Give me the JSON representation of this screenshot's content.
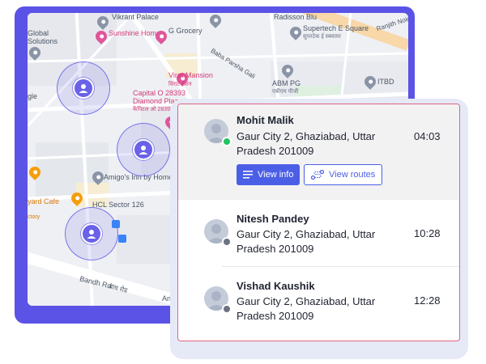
{
  "map": {
    "pois": [
      {
        "label": "Vikrant Palace",
        "style": "gray"
      },
      {
        "label": "Sunshine Homes",
        "style": "pink"
      },
      {
        "label": "G Grocery",
        "style": "gray"
      },
      {
        "label": "Radisson Blu",
        "style": "gray"
      },
      {
        "label": "Supertech E Square",
        "style": "gray"
      },
      {
        "label": "सुपरटेक ई स्क्वायर",
        "style": "sub"
      },
      {
        "label": "Global",
        "style": "gray"
      },
      {
        "label": "Solutions",
        "style": "gray"
      },
      {
        "label": "Virat Mansion",
        "style": "pink"
      },
      {
        "label": "विराट मेंशन",
        "style": "pinksub"
      },
      {
        "label": "Capital O 28393",
        "style": "pink"
      },
      {
        "label": "Diamond Plaza",
        "style": "pink"
      },
      {
        "label": "कैपिटल ओ 28393",
        "style": "pinksub"
      },
      {
        "label": "ABM PG",
        "style": "gray"
      },
      {
        "label": "एबीएम पीजी",
        "style": "sub"
      },
      {
        "label": "ITBD",
        "style": "gray"
      },
      {
        "label": "Amigo's Inn by Homestel",
        "style": "gray"
      },
      {
        "label": "yard Cafe",
        "style": "orange"
      },
      {
        "label": "ctory",
        "style": "orange"
      },
      {
        "label": "HCL Sector 126",
        "style": "gray"
      },
      {
        "label": "gle",
        "style": "gray"
      },
      {
        "label": "Anura",
        "style": "gray"
      }
    ],
    "roads": [
      {
        "label": "Baba Parsha Gali"
      },
      {
        "label": "Bandh Rd"
      },
      {
        "label": "बांध रोड"
      },
      {
        "label": "Ranjith Noida"
      }
    ]
  },
  "geofences": [
    {
      "avatar_icon": "person-icon"
    },
    {
      "avatar_icon": "person-icon"
    },
    {
      "avatar_icon": "person-icon"
    }
  ],
  "drivers": [
    {
      "name": "Mohit Malik",
      "address": "Gaur City 2, Ghaziabad, Uttar Pradesh 201009",
      "time": "04:03",
      "status": "online",
      "status_color": "#22c55e",
      "buttons": {
        "view_info": "View info",
        "view_routes": "View routes"
      }
    },
    {
      "name": "Nitesh Pandey",
      "address": "Gaur City 2, Ghaziabad, Uttar Pradesh 201009",
      "time": "10:28",
      "status": "offline",
      "status_color": "#6b7280"
    },
    {
      "name": "Vishad Kaushik",
      "address": "Gaur City 2, Ghaziabad, Uttar Pradesh 201009",
      "time": "12:28",
      "status": "offline",
      "status_color": "#6b7280"
    }
  ],
  "colors": {
    "brand_purple": "#5b52e6",
    "button_blue": "#4b5fe6",
    "panel_border": "#e0667a"
  }
}
